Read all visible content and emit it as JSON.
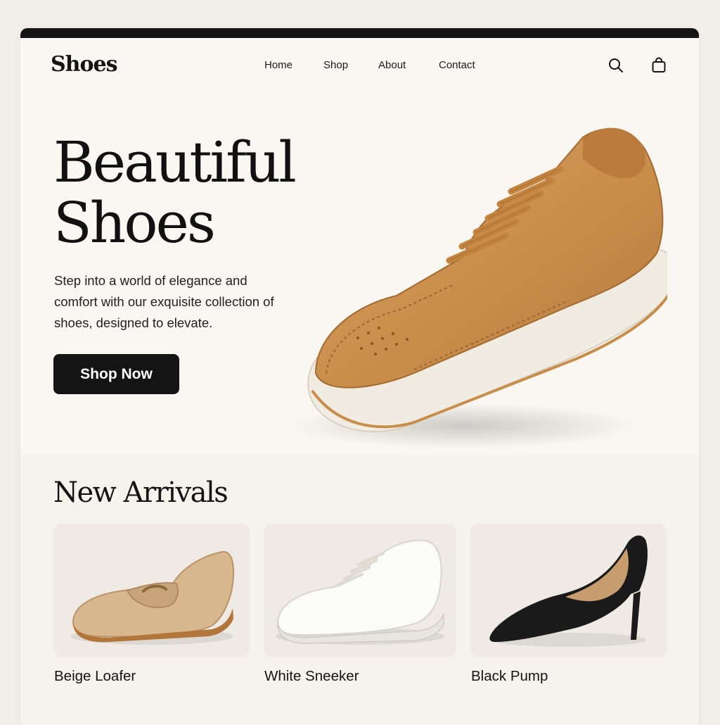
{
  "header": {
    "brand": "Shoes",
    "nav": [
      "Home",
      "Shop",
      "About",
      "Contact"
    ],
    "icons": [
      "search-icon",
      "shopping-bag-icon"
    ]
  },
  "hero": {
    "title_line1": "Beautiful",
    "title_line2": "Shoes",
    "subtitle": "Step into a world of elegance and comfort with our exquisite collection of shoes, designed to elevate.",
    "cta_label": "Shop Now"
  },
  "new_arrivals": {
    "title": "New Arrivals",
    "products": [
      {
        "name": "Beige Loafer"
      },
      {
        "name": "White Sneeker"
      },
      {
        "name": "Black Pump"
      }
    ]
  },
  "colors": {
    "page_bg": "#faf7f2",
    "ink": "#141414",
    "accent_tan": "#c98d4b",
    "sole_cream": "#f1ece2"
  }
}
